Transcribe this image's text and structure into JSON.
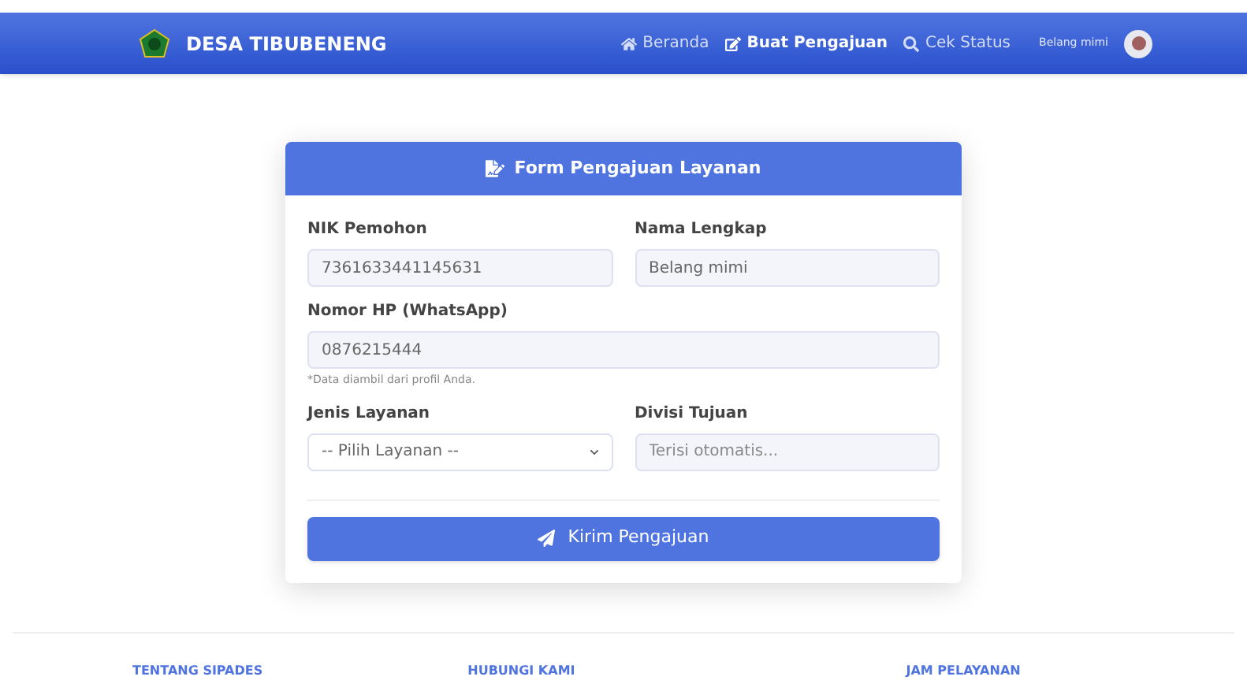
{
  "navbar": {
    "brand": "DESA TIBUBENENG",
    "links": [
      {
        "kind": "home",
        "label": "Beranda",
        "selected": false
      },
      {
        "kind": "edit",
        "label": "Buat Pengajuan",
        "selected": true
      },
      {
        "kind": "search",
        "label": "Cek Status",
        "selected": false
      }
    ],
    "user": "Belang mimi"
  },
  "form": {
    "title": "Form Pengajuan Layanan",
    "fields": [
      {
        "label": "NIK Pemohon",
        "value": "7361633441145631",
        "kind": "readonly"
      },
      {
        "label": "Nama Lengkap",
        "value": "Belang mimi",
        "kind": "readonly"
      },
      {
        "label": "Nomor HP (WhatsApp)",
        "value": "0876215444",
        "kind": "readonly",
        "hint": "*Data diambil dari profil Anda."
      },
      {
        "label": "Jenis Layanan",
        "value": "-- Pilih Layanan --",
        "kind": "select"
      },
      {
        "label": "Divisi Tujuan",
        "placeholder": "Terisi otomatis...",
        "kind": "readonly"
      }
    ],
    "submit": "Kirim Pengajuan"
  },
  "footer": {
    "headings": [
      "TENTANG SIPADES",
      "HUBUNGI KAMI",
      "JAM PELAYANAN"
    ]
  }
}
